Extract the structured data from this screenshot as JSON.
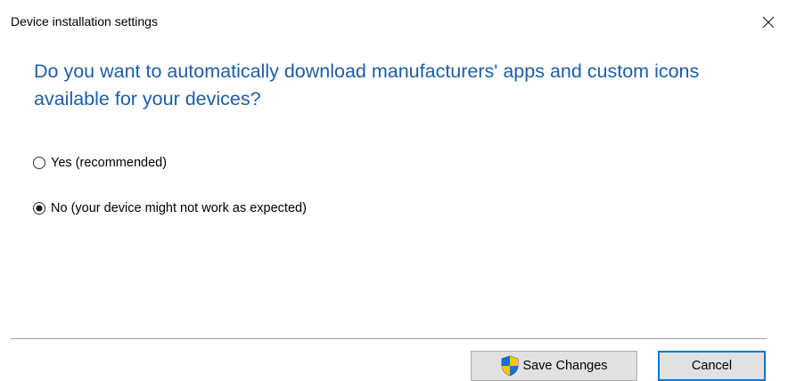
{
  "window": {
    "title": "Device installation settings",
    "close_icon": "close-icon"
  },
  "main": {
    "question": "Do you want to automatically download manufacturers' apps and custom icons available for your devices?",
    "options": [
      {
        "label": "Yes (recommended)",
        "selected": false
      },
      {
        "label": "No (your device might not work as expected)",
        "selected": true
      }
    ]
  },
  "footer": {
    "save_label": "Save Changes",
    "save_icon": "uac-shield-icon",
    "cancel_label": "Cancel"
  },
  "colors": {
    "question_text": "#1c5ea8",
    "default_button_border": "#0078d7",
    "shield_blue": "#1a73c9",
    "shield_yellow": "#f7c600"
  }
}
